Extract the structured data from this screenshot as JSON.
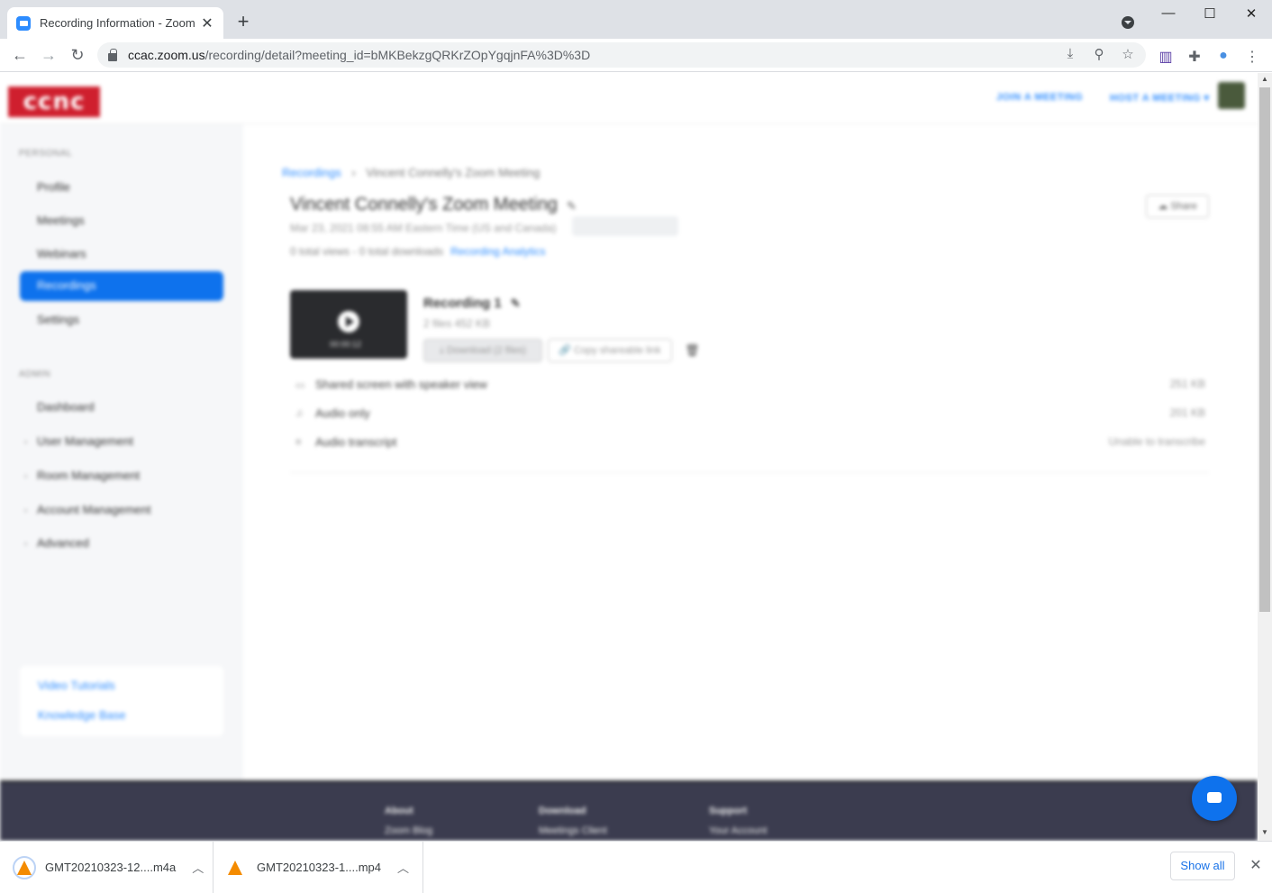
{
  "browser": {
    "tab_title": "Recording Information - Zoom",
    "tab_close": "✕",
    "new_tab": "+",
    "url_host": "ccac.zoom.us",
    "url_path": "/recording/detail?meeting_id=bMKBekzgQRKrZOpYgqjnFA%3D%3D",
    "window_buttons": [
      "—",
      "☐",
      "✕"
    ]
  },
  "header": {
    "logo_text": "ccnc",
    "join_link": "JOIN A MEETING",
    "host_link": "HOST A MEETING ▾"
  },
  "sidebar": {
    "personal_heading": "PERSONAL",
    "personal_items": [
      "Profile",
      "Meetings",
      "Webinars",
      "Recordings",
      "Settings"
    ],
    "admin_heading": "ADMIN",
    "admin_items": [
      "Dashboard",
      "User Management",
      "Room Management",
      "Account Management",
      "Advanced"
    ],
    "help_links": [
      "Video Tutorials",
      "Knowledge Base"
    ]
  },
  "meeting": {
    "breadcrumb_link": "Recordings",
    "breadcrumb_sep": "›",
    "breadcrumb_current": "Vincent Connelly's Zoom Meeting",
    "title": "Vincent Connelly's Zoom Meeting",
    "date": "Mar 23, 2021 08:55 AM Eastern Time (US and Canada)",
    "stats": "0 total views - 0 total downloads",
    "analytics_link": "Recording Analytics",
    "share_button": "Share"
  },
  "recording": {
    "title": "Recording 1",
    "meta": "2 files  452 KB",
    "duration": "00:00:12",
    "download_button": "Download (2 files)",
    "copy_button": "Copy shareable link",
    "files": [
      {
        "name": "Shared screen with speaker view",
        "size": "251 KB",
        "icon": "▭"
      },
      {
        "name": "Audio only",
        "size": "201 KB",
        "icon": "♫"
      },
      {
        "name": "Audio transcript",
        "size": "Unable to transcribe",
        "icon": "≡"
      }
    ]
  },
  "footer": {
    "col1": {
      "heading": "About",
      "item": "Zoom Blog"
    },
    "col2": {
      "heading": "Download",
      "item": "Meetings Client"
    },
    "col3": {
      "heading": "Support",
      "item": "Your Account"
    }
  },
  "downloads": {
    "items": [
      {
        "name": "GMT20210323-12....m4a"
      },
      {
        "name": "GMT20210323-1....mp4"
      }
    ],
    "show_all": "Show all",
    "close": "✕"
  },
  "colors": {
    "accent": "#0e72ed",
    "brand_red": "#cf1f2e",
    "footer_bg": "#3b3c4f"
  }
}
